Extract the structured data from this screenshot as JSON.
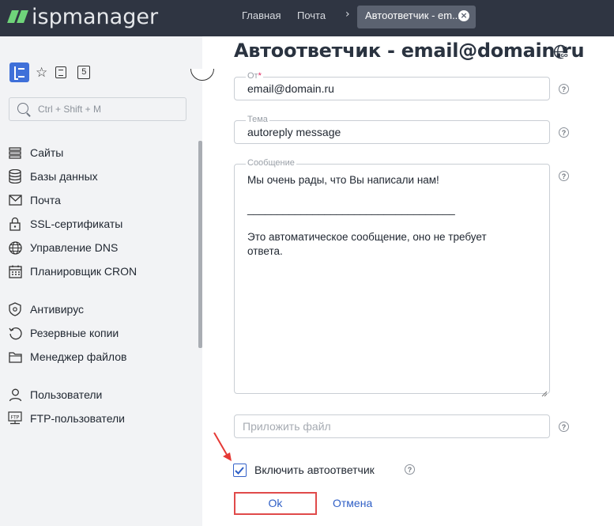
{
  "app": {
    "logo_text": "ispmanager",
    "brand_color": "#6fd47a"
  },
  "header": {
    "tabs": [
      {
        "label": "Главная"
      },
      {
        "label": "Почта"
      }
    ],
    "active_tab": {
      "label": "Автоответчик - em..."
    }
  },
  "sidebar": {
    "badge_count": "5",
    "search_placeholder": "Ctrl + Shift + M",
    "items": [
      {
        "label": "Сайты",
        "icon": "sites-icon"
      },
      {
        "label": "Базы данных",
        "icon": "database-icon"
      },
      {
        "label": "Почта",
        "icon": "mail-icon"
      },
      {
        "label": "SSL-сертификаты",
        "icon": "lock-icon"
      },
      {
        "label": "Управление DNS",
        "icon": "globe-icon"
      },
      {
        "label": "Планировщик CRON",
        "icon": "calendar-icon"
      },
      {
        "label": "Антивирус",
        "icon": "shield-icon"
      },
      {
        "label": "Резервные копии",
        "icon": "backup-icon"
      },
      {
        "label": "Менеджер файлов",
        "icon": "folder-icon"
      },
      {
        "label": "Пользователи",
        "icon": "user-icon"
      },
      {
        "label": "FTP-пользователи",
        "icon": "ftp-icon"
      }
    ],
    "ftp_icon_text": "FTP"
  },
  "main": {
    "title": "Автоответчик - email@domain.ru",
    "from": {
      "label": "От",
      "required_mark": "*",
      "value": "email@domain.ru"
    },
    "subject": {
      "label": "Тема",
      "value": "autoreply message"
    },
    "message": {
      "label": "Сообщение",
      "line1": "Мы очень рады, что Вы написали нам!",
      "separator": "___________________________________",
      "line2": "Это автоматическое сообщение, оно не требует",
      "line3": "ответа."
    },
    "attach": {
      "placeholder": "Приложить файл"
    },
    "enable": {
      "label": "Включить автоответчик",
      "checked": true
    },
    "help_glyph": "?",
    "ok_label": "Ok",
    "cancel_label": "Отмена"
  }
}
